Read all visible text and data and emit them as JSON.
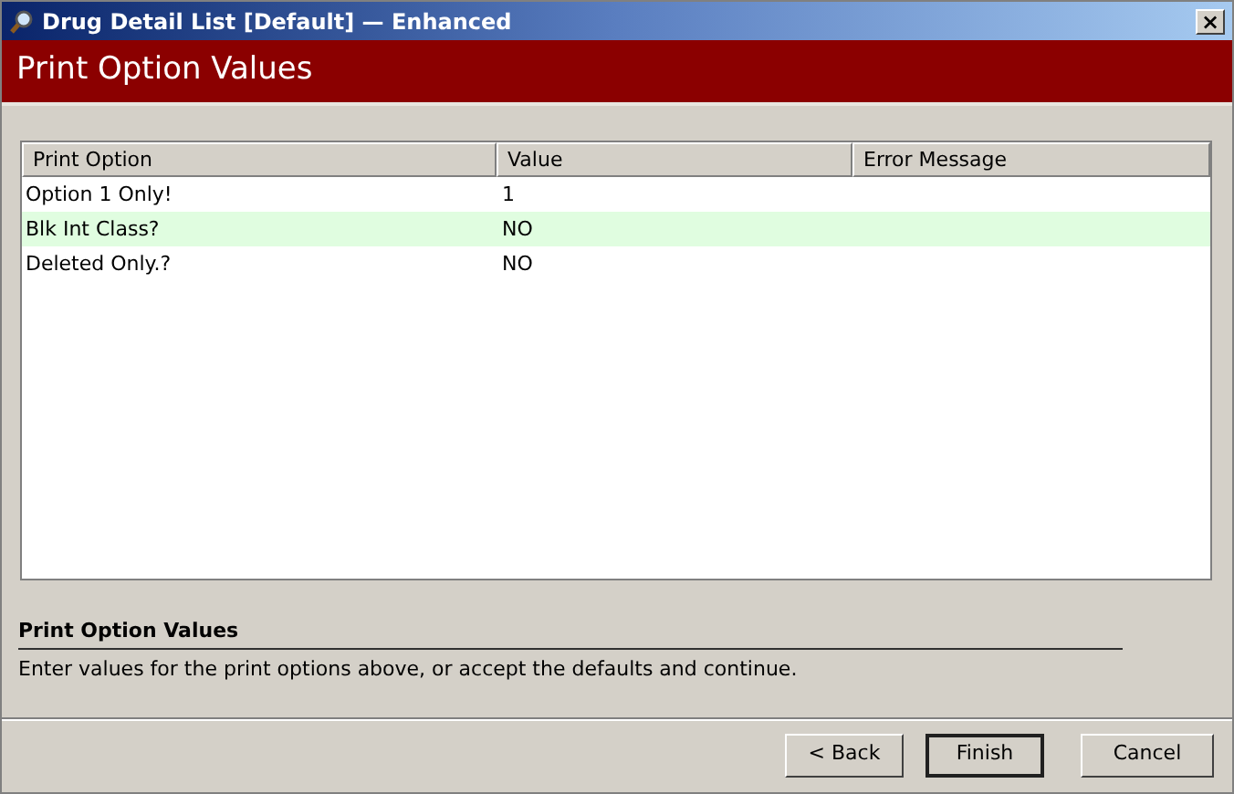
{
  "window": {
    "title": "Drug Detail List [Default] — Enhanced",
    "close": "×"
  },
  "header": {
    "title": "Print Option Values"
  },
  "table": {
    "columns": [
      "Print Option",
      "Value",
      "Error Message"
    ],
    "rows": [
      {
        "cells": [
          "Option 1 Only!",
          "1",
          ""
        ],
        "selected": false
      },
      {
        "cells": [
          "Blk Int Class?",
          "NO",
          ""
        ],
        "selected": true
      },
      {
        "cells": [
          "Deleted Only.?",
          "NO",
          ""
        ],
        "selected": false
      }
    ]
  },
  "description": {
    "title": "Print Option Values",
    "text": "Enter values for the print options above, or accept the defaults and continue."
  },
  "buttons": [
    {
      "label": "< Back",
      "default": false
    },
    {
      "label": "Finish",
      "default": true
    },
    {
      "label": "Cancel",
      "default": false
    }
  ]
}
